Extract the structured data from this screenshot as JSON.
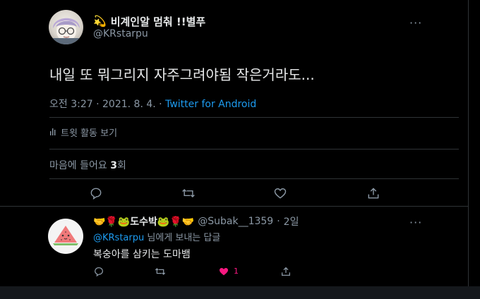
{
  "tweet": {
    "display_name_emoji": "💫",
    "display_name": "비계인알 멈춰 !!별푸",
    "handle": "@KRstarpu",
    "text": "내일 또 뭐그리지 자주그려야됨 작은거라도...",
    "time": "오전 3:27",
    "date": "2021. 8. 4.",
    "separator": "·",
    "client": "Twitter for Android",
    "activity_label": "트윗 활동 보기",
    "likes_label_before": "마음에 들어요 ",
    "likes_count": "3",
    "likes_label_after": "회"
  },
  "reply": {
    "display_name": "🤝🌹🐸도수박🐸🌹🤝",
    "handle": "@Subak__1359",
    "time": "2일",
    "replying_to_mention": "@KRstarpu",
    "replying_to_suffix": " 님에게 보내는 답글",
    "text": "복숭아를 삼키는 도마뱀",
    "like_count": "1"
  },
  "colors": {
    "background": "#000000",
    "accent": "#1d9bf0",
    "like": "#f91880",
    "muted": "#8b98a5"
  }
}
